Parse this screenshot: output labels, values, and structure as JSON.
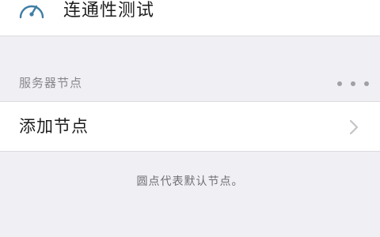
{
  "connectivity_row": {
    "label": "连通性测试",
    "icon": "speedometer-icon"
  },
  "server_section": {
    "title": "服务器节点",
    "more_icon": "ellipsis-icon"
  },
  "add_node_row": {
    "label": "添加节点",
    "icon": "chevron-right-icon"
  },
  "footnote": "圆点代表默认节点。",
  "colors": {
    "background": "#efeff4",
    "row_background": "#ffffff",
    "icon_blue": "#3f7ea6",
    "secondary_text": "#86868b"
  }
}
